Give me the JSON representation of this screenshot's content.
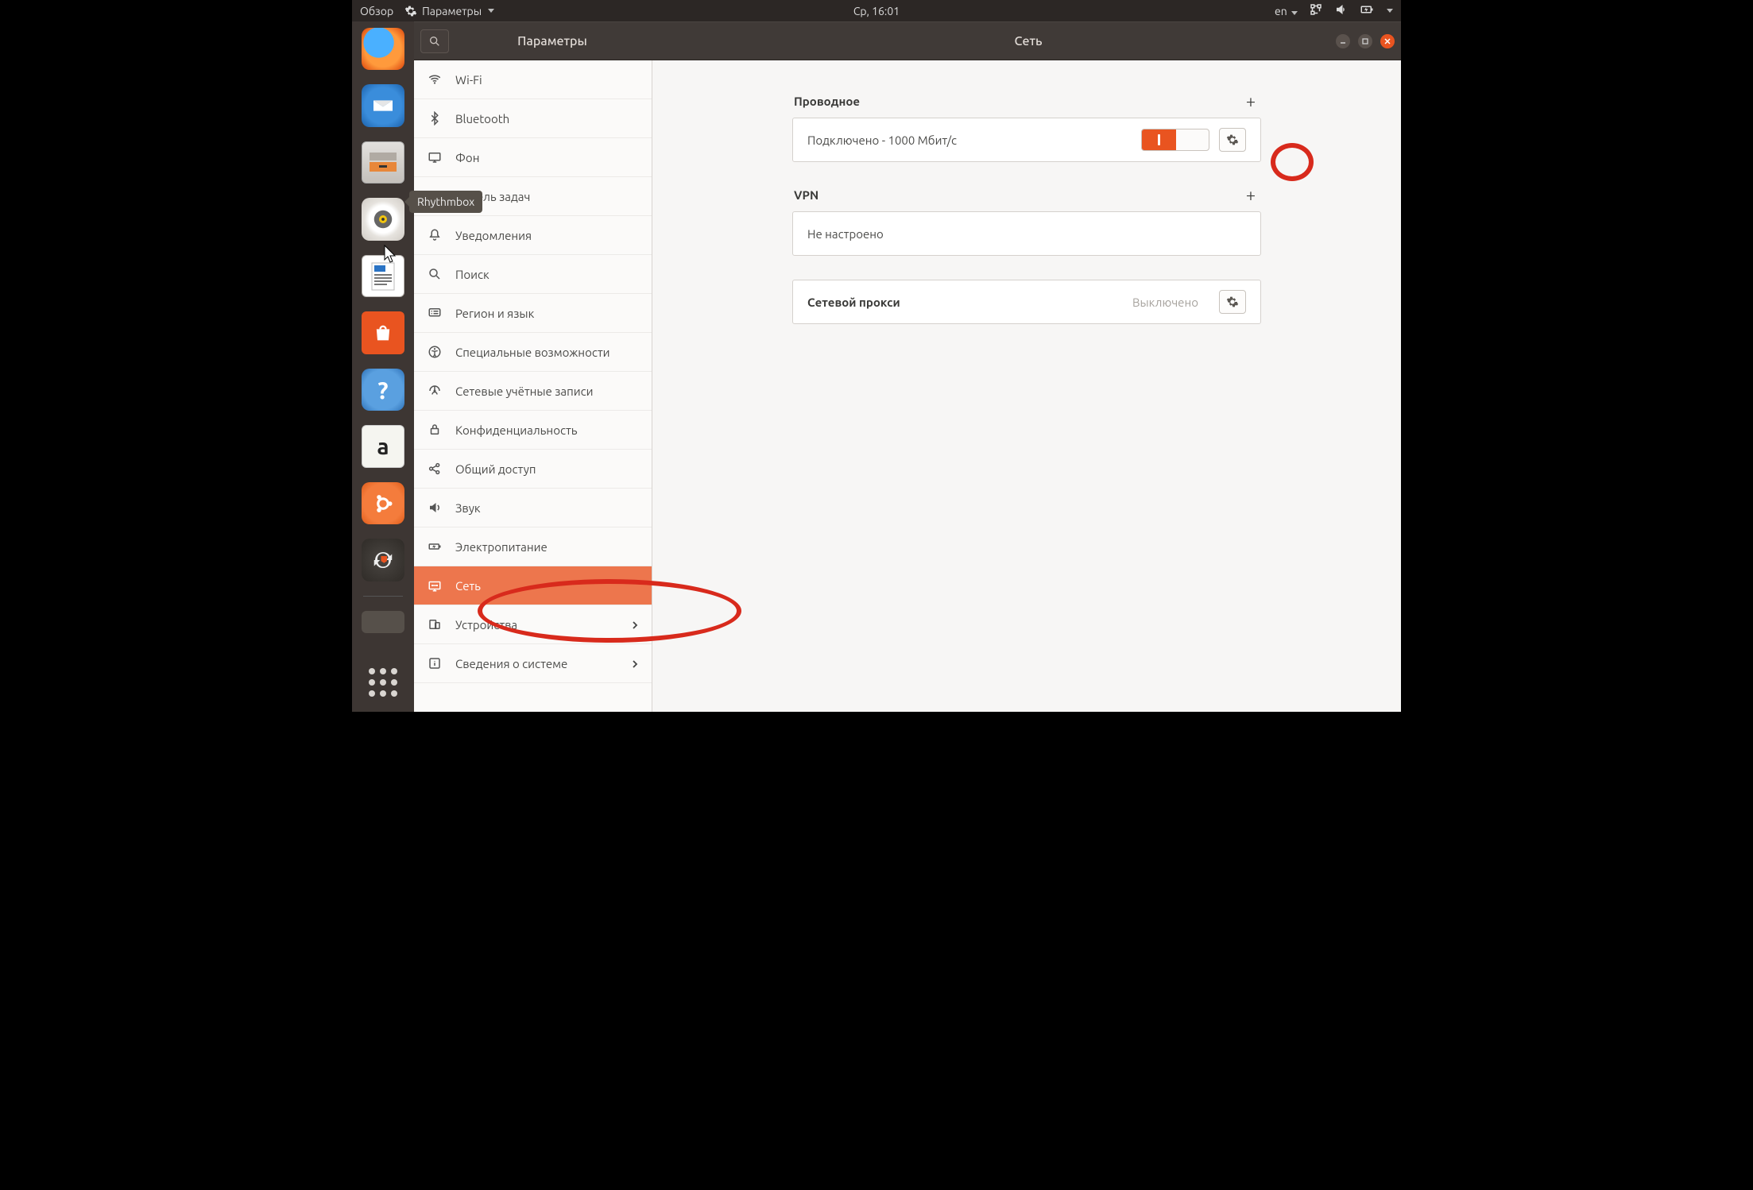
{
  "top_panel": {
    "activities": "Обзор",
    "app_menu": "Параметры",
    "clock": "Ср, 16:01",
    "lang": "en"
  },
  "dock": {
    "tooltip": "Rhythmbox"
  },
  "window": {
    "left_title": "Параметры",
    "main_title": "Сеть"
  },
  "sidebar": {
    "items": [
      {
        "label": "Wi-Fi",
        "icon": "wifi"
      },
      {
        "label": "Bluetooth",
        "icon": "bluetooth"
      },
      {
        "label": "Фон",
        "icon": "background"
      },
      {
        "label": "Панель задач",
        "icon": "dock"
      },
      {
        "label": "Уведомления",
        "icon": "notifications"
      },
      {
        "label": "Поиск",
        "icon": "search"
      },
      {
        "label": "Регион и язык",
        "icon": "region"
      },
      {
        "label": "Специальные возможности",
        "icon": "a11y"
      },
      {
        "label": "Сетевые учётные записи",
        "icon": "online-accounts"
      },
      {
        "label": "Конфиденциальность",
        "icon": "privacy"
      },
      {
        "label": "Общий доступ",
        "icon": "sharing"
      },
      {
        "label": "Звук",
        "icon": "sound"
      },
      {
        "label": "Электропитание",
        "icon": "power"
      },
      {
        "label": "Сеть",
        "icon": "network",
        "selected": true
      },
      {
        "label": "Устройства",
        "icon": "devices",
        "chevron": true
      },
      {
        "label": "Сведения о системе",
        "icon": "details",
        "chevron": true
      }
    ]
  },
  "content": {
    "wired": {
      "title": "Проводное",
      "status": "Подключено - 1000 Мбит/с"
    },
    "vpn": {
      "title": "VPN",
      "status": "Не настроено"
    },
    "proxy": {
      "title": "Сетевой прокси",
      "status": "Выключено"
    }
  }
}
